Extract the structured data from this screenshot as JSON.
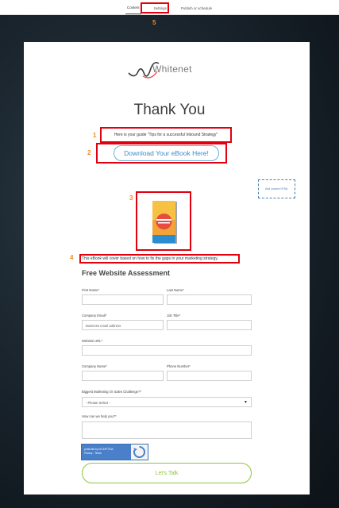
{
  "topbar": {
    "tabs": [
      "Content",
      "Settings",
      "Publish or schedule"
    ],
    "active_tab": "Content"
  },
  "annotations": [
    "1",
    "2",
    "3",
    "4",
    "5"
  ],
  "logo": {
    "text": "Whitenet"
  },
  "page": {
    "title": "Thank You",
    "guide_text": "Here is your guide \"Tips for a successful Inbound Strategy\"",
    "download_button": "Download Your eBook Here!",
    "placeholder_module": "Add custom HTML",
    "ebook_description": "This eBook will cover based on how to fix the gaps in your marketing strategy."
  },
  "form": {
    "title": "Free Website Assessment",
    "first_name_label": "First Name*",
    "last_name_label": "Last Name*",
    "company_email_label": "Company Email*",
    "company_email_placeholder": "Business email address",
    "job_title_label": "Job Title*",
    "website_label": "Website URL*",
    "company_name_label": "Company Name*",
    "phone_label": "Phone Number*",
    "challenge_label": "Biggest Marketing Or Sales Challenge?*",
    "challenge_selected": "- Please Select -",
    "help_label": "How can we help you?*",
    "captcha_line1": "protected by reCAPTCHA",
    "captcha_line2": "Privacy - Terms",
    "submit_label": "Let's Talk"
  },
  "colors": {
    "annotation_red": "#e0000e",
    "annotation_number": "#f08a1c",
    "link_blue": "#3a8cc9",
    "submit_green": "#8dc63f"
  }
}
